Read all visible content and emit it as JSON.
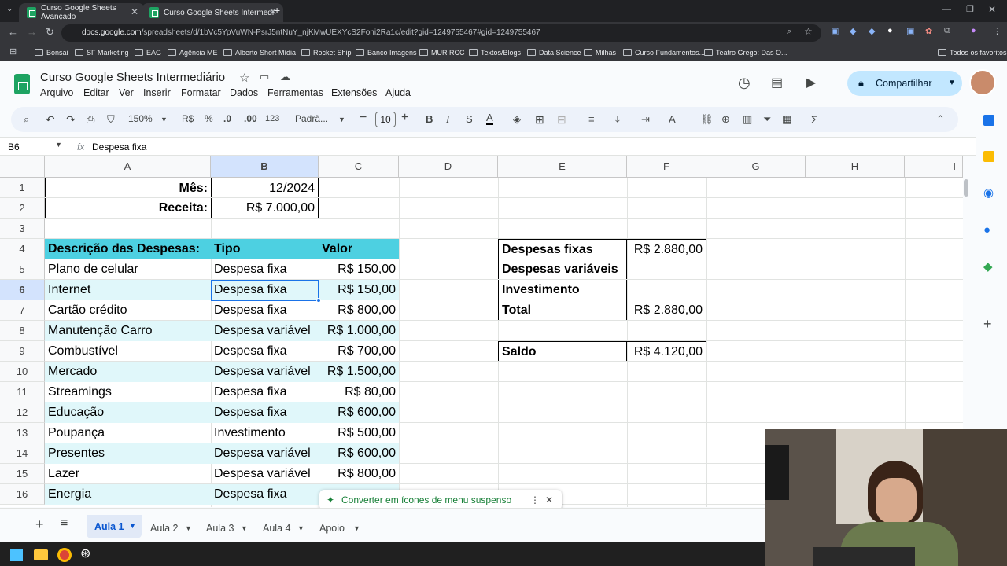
{
  "browser": {
    "tabs": [
      {
        "title": "Curso Google Sheets Avançado"
      },
      {
        "title": "Curso Google Sheets Intermedi"
      }
    ],
    "url_host": "docs.google.com",
    "url_path": "/spreadsheets/d/1bVc5YpVuWN-PsrJ5ntNuY_njKMwUEXYcS2Foni2Ra1c/edit?gid=1249755467#gid=1249755467",
    "bookmarks": [
      "Bonsai",
      "SF Marketing",
      "EAG",
      "Agência ME",
      "Alberto Short Mídia",
      "Rocket Ship",
      "Banco Imagens",
      "MUR RCC",
      "Textos/Blogs",
      "Data Science",
      "Milhas",
      "Curso Fundamentos...",
      "Teatro Grego: Das O..."
    ],
    "all_bookmarks": "Todos os favoritos"
  },
  "app": {
    "title": "Curso Google Sheets Intermediário",
    "menu": [
      "Arquivo",
      "Editar",
      "Ver",
      "Inserir",
      "Formatar",
      "Dados",
      "Ferramentas",
      "Extensões",
      "Ajuda"
    ],
    "share_label": "Compartilhar"
  },
  "toolbar": {
    "zoom": "150%",
    "currency": "R$",
    "percent": "%",
    "dec_less": ".0",
    "dec_more": ".00",
    "format_num": "123",
    "font": "Padrã...",
    "font_size": "10"
  },
  "formula_bar": {
    "cell_ref": "B6",
    "fx": "fx",
    "content": "Despesa fixa"
  },
  "columns": [
    "A",
    "B",
    "C",
    "D",
    "E",
    "F",
    "G",
    "H",
    "I"
  ],
  "rows": [
    "1",
    "2",
    "3",
    "4",
    "5",
    "6",
    "7",
    "8",
    "9",
    "10",
    "11",
    "12",
    "13",
    "14",
    "15",
    "16"
  ],
  "sheet": {
    "mes_label": "Mês:",
    "mes_value": "12/2024",
    "receita_label": "Receita:",
    "receita_value": "R$ 7.000,00",
    "headers": [
      "Descrição das Despesas:",
      "Tipo",
      "Valor"
    ],
    "expenses": [
      [
        "Plano de celular",
        "Despesa fixa",
        "R$ 150,00"
      ],
      [
        "Internet",
        "Despesa fixa",
        "R$ 150,00"
      ],
      [
        "Cartão crédito",
        "Despesa fixa",
        "R$ 800,00"
      ],
      [
        "Manutenção Carro",
        "Despesa variável",
        "R$ 1.000,00"
      ],
      [
        "Combustível",
        "Despesa fixa",
        "R$ 700,00"
      ],
      [
        "Mercado",
        "Despesa variável",
        "R$ 1.500,00"
      ],
      [
        "Streamings",
        "Despesa fixa",
        "R$ 80,00"
      ],
      [
        "Educação",
        "Despesa fixa",
        "R$ 600,00"
      ],
      [
        "Poupança",
        "Investimento",
        "R$ 500,00"
      ],
      [
        "Presentes",
        "Despesa variável",
        "R$ 600,00"
      ],
      [
        "Lazer",
        "Despesa variável",
        "R$ 800,00"
      ],
      [
        "Energia",
        "Despesa fixa",
        ""
      ]
    ],
    "summary": [
      [
        "Despesas fixas",
        "R$ 2.880,00"
      ],
      [
        "Despesas variáveis",
        ""
      ],
      [
        "Investimento",
        ""
      ],
      [
        "Total",
        "R$ 2.880,00"
      ]
    ],
    "saldo_label": "Saldo",
    "saldo_value": "R$ 4.120,00"
  },
  "toast": {
    "text": "Converter em ícones de menu suspenso"
  },
  "sheet_tabs": [
    "Aula 1",
    "Aula 2",
    "Aula 3",
    "Aula 4",
    "Apoio"
  ],
  "colors": {
    "header_teal": "#4dd0e1",
    "stripe": "#e0f7fa",
    "accent_blue": "#1a73e8",
    "share_bg": "#c2e7ff"
  }
}
